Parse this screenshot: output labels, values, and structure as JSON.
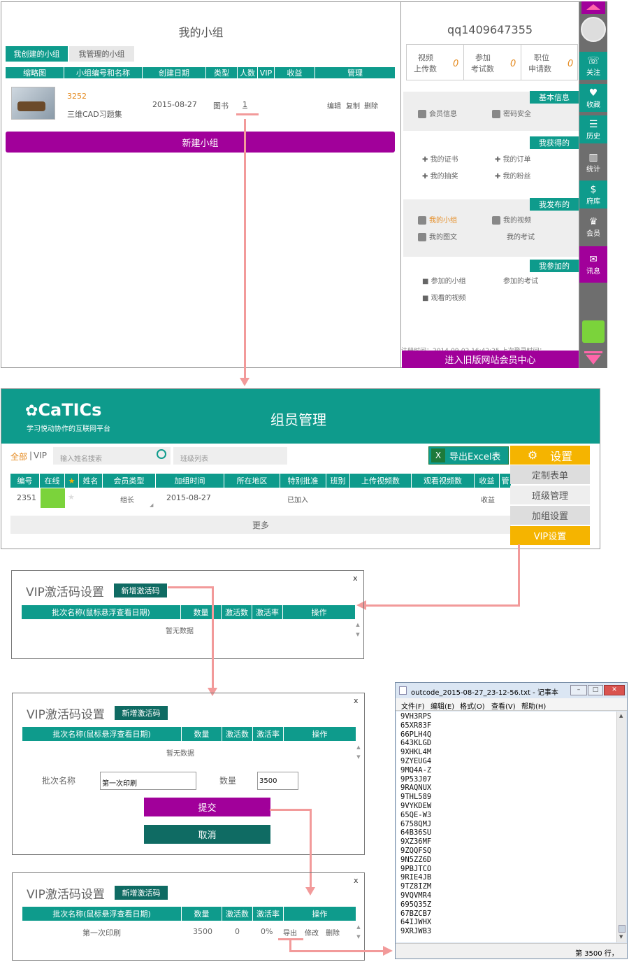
{
  "panel1": {
    "title": "我的小组",
    "tabs": [
      "我创建的小组",
      "我管理的小组"
    ],
    "columns": [
      "缩略图",
      "小组编号和名称",
      "创建日期",
      "类型",
      "人数",
      "VIP",
      "收益",
      "管理"
    ],
    "row": {
      "id": "3252",
      "name": "三维CAD习题集",
      "date": "2015-08-27",
      "type": "图书",
      "count": "1",
      "actions": [
        "编辑",
        "复制",
        "删除"
      ]
    },
    "new_group": "新建小组"
  },
  "member_panel": {
    "username": "qq1409647355",
    "stats": [
      {
        "label1": "视频",
        "label2": "上传数",
        "value": "0"
      },
      {
        "label1": "参加",
        "label2": "考试数",
        "value": "0"
      },
      {
        "label1": "职位",
        "label2": "申请数",
        "value": "0"
      }
    ],
    "sections": [
      {
        "title": "基本信息",
        "items": [
          "会员信息",
          "密码安全"
        ]
      },
      {
        "title": "我获得的",
        "items": [
          "我的证书",
          "我的订单",
          "我的抽奖",
          "我的粉丝"
        ]
      },
      {
        "title": "我发布的",
        "items": [
          "我的小组",
          "我的视频",
          "我的图文",
          "我的考试"
        ]
      },
      {
        "title": "我参加的",
        "items": [
          "参加的小组",
          "参加的考试",
          "观看的视频"
        ]
      }
    ],
    "footer_partial": "注册时间：2014-09-02 16:42:25    上次登录时间：",
    "old_center": "进入旧版网站会员中心"
  },
  "sidebar": {
    "items": [
      "关注",
      "收藏",
      "历史",
      "统计",
      "府库",
      "会员",
      "讯息"
    ]
  },
  "panel2": {
    "logo": "CaTICs",
    "slogan": "学习悦动协作的互联网平台",
    "title": "组员管理",
    "filter_all": "全部",
    "filter_vip": "VIP",
    "search_placeholder": "输入姓名搜索",
    "class_list": "班级列表",
    "export": "导出Excel表",
    "settings": "设置",
    "menu": [
      "定制表单",
      "班级管理",
      "加组设置",
      "VIP设置"
    ],
    "columns": [
      "编号",
      "在线",
      "★",
      "姓名",
      "会员类型",
      "加组时间",
      "所在地区",
      "特别批准",
      "班别",
      "上传视频数",
      "观看视频数",
      "收益",
      "管"
    ],
    "row": {
      "id": "2351",
      "type": "组长",
      "time": "2015-08-27",
      "approval": "已加入",
      "income": "收益"
    },
    "more": "更多"
  },
  "vip_dialog": {
    "title": "VIP激活码设置",
    "add_btn": "新增激活码",
    "columns": [
      "批次名称(鼠标悬浮查看日期)",
      "数量",
      "激活数",
      "激活率",
      "操作"
    ],
    "empty": "暂无数据",
    "close": "x",
    "form": {
      "batch_label": "批次名称",
      "batch_value": "第一次印刷",
      "qty_label": "数量",
      "qty_value": "3500",
      "submit": "提交",
      "cancel": "取消"
    },
    "result_row": {
      "name": "第一次印刷",
      "qty": "3500",
      "activated": "0",
      "rate": "0%",
      "actions": [
        "导出",
        "修改",
        "删除"
      ]
    }
  },
  "notepad": {
    "title": "outcode_2015-08-27_23-12-56.txt - 记事本",
    "menu": [
      "文件(F)",
      "编辑(E)",
      "格式(O)",
      "查看(V)",
      "帮助(H)"
    ],
    "lines": [
      "9VH3RPS",
      "65XR83F",
      "66PLH4Q",
      "643KLGD",
      "9XHKL4M",
      "9ZYEUG4",
      "9MQ4A-Z",
      "9P53J07",
      "9RAQNUX",
      "9THL589",
      "9VYKDEW",
      "65QE-W3",
      "6758QMJ",
      "64B36SU",
      "9XZ36MF",
      "9ZQQFSQ",
      "9N5ZZ6D",
      "9PBJTCO",
      "9RIE4JB",
      "9TZ8IZM",
      "9VQVMR4",
      "695Q35Z",
      "67BZCB7",
      "64IJWHX",
      "9XRJWB3"
    ],
    "status": "第 3500 行，"
  }
}
